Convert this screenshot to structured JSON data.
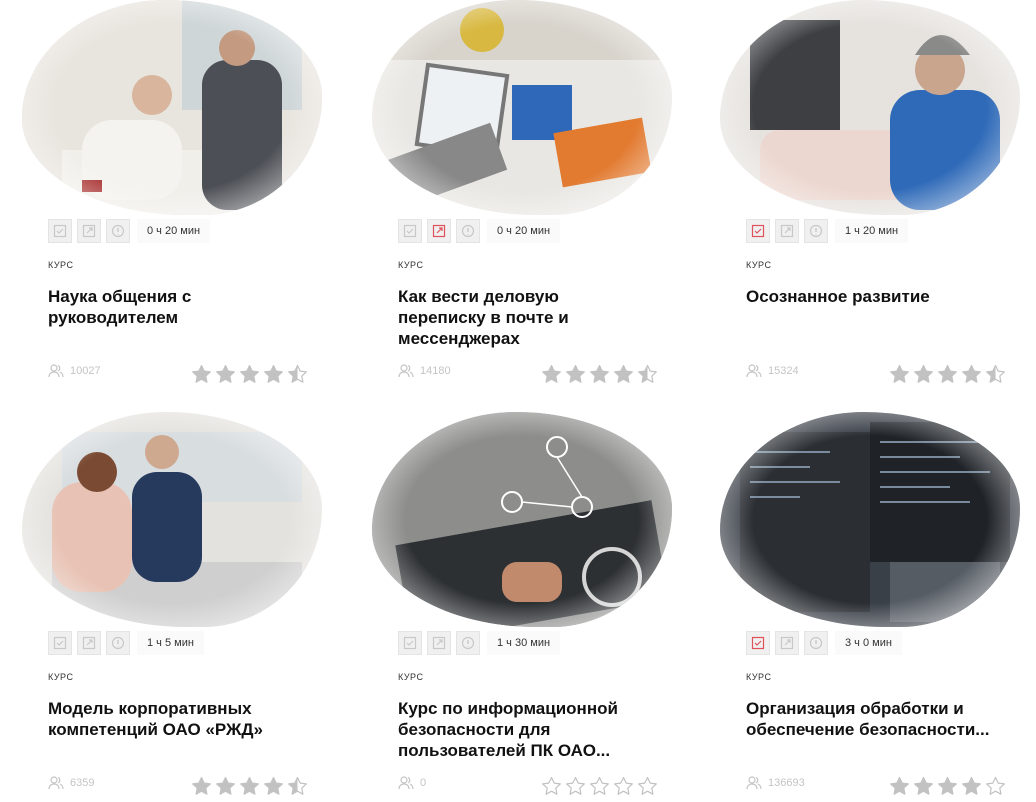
{
  "colors": {
    "accent": "#e0525b",
    "icon_inactive": "#c8c8c8",
    "star_filled": "#c2c2c2"
  },
  "cards": [
    {
      "kind": "КУРС",
      "title": "Наука общения с руководителем",
      "duration": "0 ч 20 мин",
      "users": "10027",
      "rating": 4.5,
      "active_icon": -1
    },
    {
      "kind": "КУРС",
      "title": "Как вести деловую переписку в почте и мессенджерах",
      "duration": "0 ч 20 мин",
      "users": "14180",
      "rating": 4.5,
      "active_icon": 1
    },
    {
      "kind": "КУРС",
      "title": "Осознанное развитие",
      "duration": "1 ч 20 мин",
      "users": "15324",
      "rating": 4.5,
      "active_icon": 0
    },
    {
      "kind": "КУРС",
      "title": "Модель корпоративных компетенций ОАО «РЖД»",
      "duration": "1 ч 5 мин",
      "users": "6359",
      "rating": 4.5,
      "active_icon": -1
    },
    {
      "kind": "КУРС",
      "title": "Курс по информационной безопасности для пользователей ПК ОАО...",
      "duration": "1 ч 30 мин",
      "users": "0",
      "rating": 0,
      "active_icon": -1
    },
    {
      "kind": "КУРС",
      "title": "Организация обработки и обеспечение безопасности...",
      "duration": "3 ч 0 мин",
      "users": "136693",
      "rating": 4,
      "active_icon": 0
    }
  ],
  "icon_names": [
    "checklist-icon",
    "external-link-icon",
    "info-icon"
  ]
}
